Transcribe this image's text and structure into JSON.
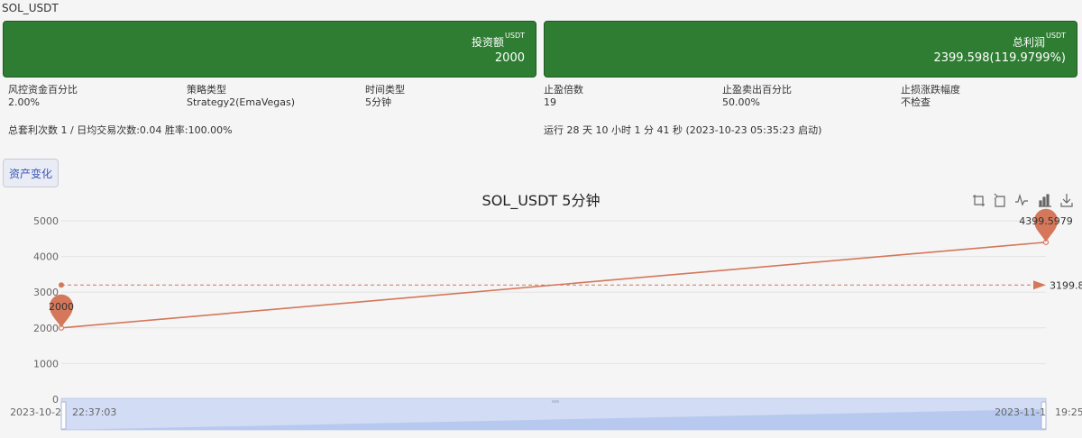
{
  "header": {
    "title": "SOL_USDT"
  },
  "summary": {
    "investment": {
      "label": "投资额",
      "unit": "USDT",
      "value": "2000"
    },
    "profit": {
      "label": "总利润",
      "unit": "USDT",
      "value": "2399.598(119.9799%)"
    }
  },
  "params": [
    {
      "label": "风控资金百分比",
      "value": "2.00%"
    },
    {
      "label": "策略类型",
      "value": "Strategy2(EmaVegas)"
    },
    {
      "label": "时间类型",
      "value": "5分钟"
    },
    {
      "label": "止盈倍数",
      "value": "19"
    },
    {
      "label": "止盈卖出百分比",
      "value": "50.00%"
    },
    {
      "label": "止损涨跌幅度",
      "value": "不检查"
    }
  ],
  "stats": {
    "trades": "总套利次数 1 / 日均交易次数:0.04 胜率:100.00%",
    "runtime": "运行 28 天 10 小时 1 分 41 秒 (2023-10-23 05:35:23 启动)"
  },
  "tabs": [
    {
      "label": "资产变化",
      "active": true
    }
  ],
  "toolbox": [
    "zoom-icon",
    "zoom-reset-icon",
    "line-chart-icon",
    "bar-chart-icon",
    "download-icon"
  ],
  "chart_data": {
    "type": "line",
    "title": "SOL_USDT 5分钟",
    "x": [
      "2023-10-21 22:37:03",
      "2023-11-17 19:25"
    ],
    "x_tick_labels": [
      "2023-10-21 22:37:03",
      "2023-11-17 19:25"
    ],
    "series": [
      {
        "values": [
          2000,
          4399.5979
        ],
        "color": "#d4775a"
      }
    ],
    "ylim": [
      0,
      5000
    ],
    "yticks": [
      0,
      1000,
      2000,
      3000,
      4000,
      5000
    ],
    "mark_points": [
      {
        "x": "2023-10-21 22:37:03",
        "y": 2000,
        "label": "2000"
      },
      {
        "x": "2023-11-17 19:25",
        "y": 4399.5979,
        "label": "4399.5979"
      }
    ],
    "mark_line": {
      "y": 3199.8,
      "label": "3199.8"
    },
    "grid": true,
    "data_zoom": {
      "start_label": "2023-10-2",
      "end_label": "2023-11-1"
    }
  }
}
